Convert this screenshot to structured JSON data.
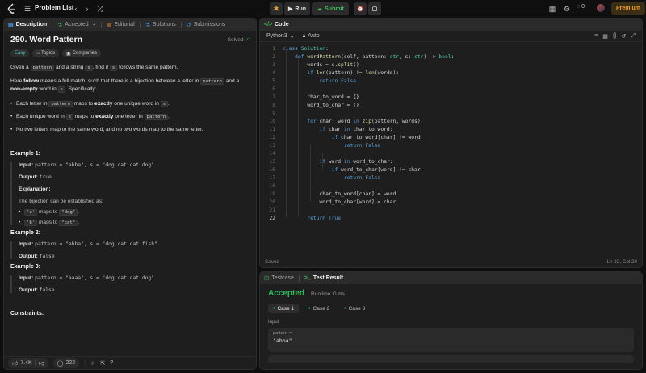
{
  "topbar": {
    "title": "Problem List",
    "run_label": "Run",
    "submit_label": "Submit",
    "streak": "0",
    "premium_label": "Premium"
  },
  "left": {
    "tabs": [
      "Description",
      "Accepted",
      "Editorial",
      "Solutions",
      "Submissions"
    ],
    "title": "290. Word Pattern",
    "solved_label": "Solved",
    "tags": [
      "Easy",
      "Topics",
      "Companies"
    ],
    "desc": {
      "p1_a": "Given a ",
      "p1_code1": "pattern",
      "p1_b": " and a string ",
      "p1_code2": "s",
      "p1_c": ", find if ",
      "p1_code3": "s",
      "p1_d": " follows the same pattern.",
      "p2_a": "Here ",
      "p2_b": "follow",
      "p2_c": " means a full match, such that there is a bijection between a letter in ",
      "p2_code": "pattern",
      "p2_d": " and a ",
      "p2_e": "non-empty",
      "p2_f": " word in ",
      "p2_code2": "s",
      "p2_g": ". Specifically:",
      "b1_a": "Each letter in ",
      "b1_code": "pattern",
      "b1_b": " maps to ",
      "b1_c": "exactly",
      "b1_d": " one unique word in ",
      "b1_code2": "s",
      "b1_e": ".",
      "b2_a": "Each unique word in ",
      "b2_code": "s",
      "b2_b": " maps to ",
      "b2_c": "exactly",
      "b2_d": " one letter in ",
      "b2_code2": "pattern",
      "b2_e": ".",
      "b3": "No two letters map to the same word, and no two words map to the same letter."
    },
    "examples": {
      "ex1_head": "Example 1:",
      "ex1_input_label": "Input:",
      "ex1_input": "pattern = \"abba\", s = \"dog cat cat dog\"",
      "ex1_output_label": "Output:",
      "ex1_output": "true",
      "ex1_expl_label": "Explanation:",
      "ex1_expl": "The bijection can be established as:",
      "ex1_b1_code": "'a'",
      "ex1_b1_mid": " maps to ",
      "ex1_b1_code2": "\"dog\"",
      "ex1_b1_end": ".",
      "ex1_b2_code": "'b'",
      "ex1_b2_mid": " maps to ",
      "ex1_b2_code2": "\"cat\"",
      "ex1_b2_end": ".",
      "ex2_head": "Example 2:",
      "ex2_input_label": "Input:",
      "ex2_input": "pattern = \"abba\", s = \"dog cat cat fish\"",
      "ex2_output_label": "Output:",
      "ex2_output": "false",
      "ex3_head": "Example 3:",
      "ex3_input_label": "Input:",
      "ex3_input": "pattern = \"aaaa\", s = \"dog cat cat dog\"",
      "ex3_output_label": "Output:",
      "ex3_output": "false",
      "constraints_head": "Constraints:"
    },
    "footer": {
      "likes": "7.4K",
      "comments": "222"
    }
  },
  "editor": {
    "header": "Code",
    "language": "Python3",
    "mode": "Auto",
    "status_left": "Saved",
    "status_right": "Ln 22, Col 20",
    "current_line": 22
  },
  "results": {
    "tabs": [
      "Testcase",
      "Test Result"
    ],
    "status": "Accepted",
    "runtime": "Runtime: 0 ms",
    "cases": [
      "Case 1",
      "Case 2",
      "Case 3"
    ],
    "input_label": "Input",
    "input_key": "pattern =",
    "input_value": "\"abba\""
  },
  "colors": {
    "accent_green": "#2cbb5d",
    "premium": "#f0a12a",
    "keyword": "#569cd6"
  }
}
